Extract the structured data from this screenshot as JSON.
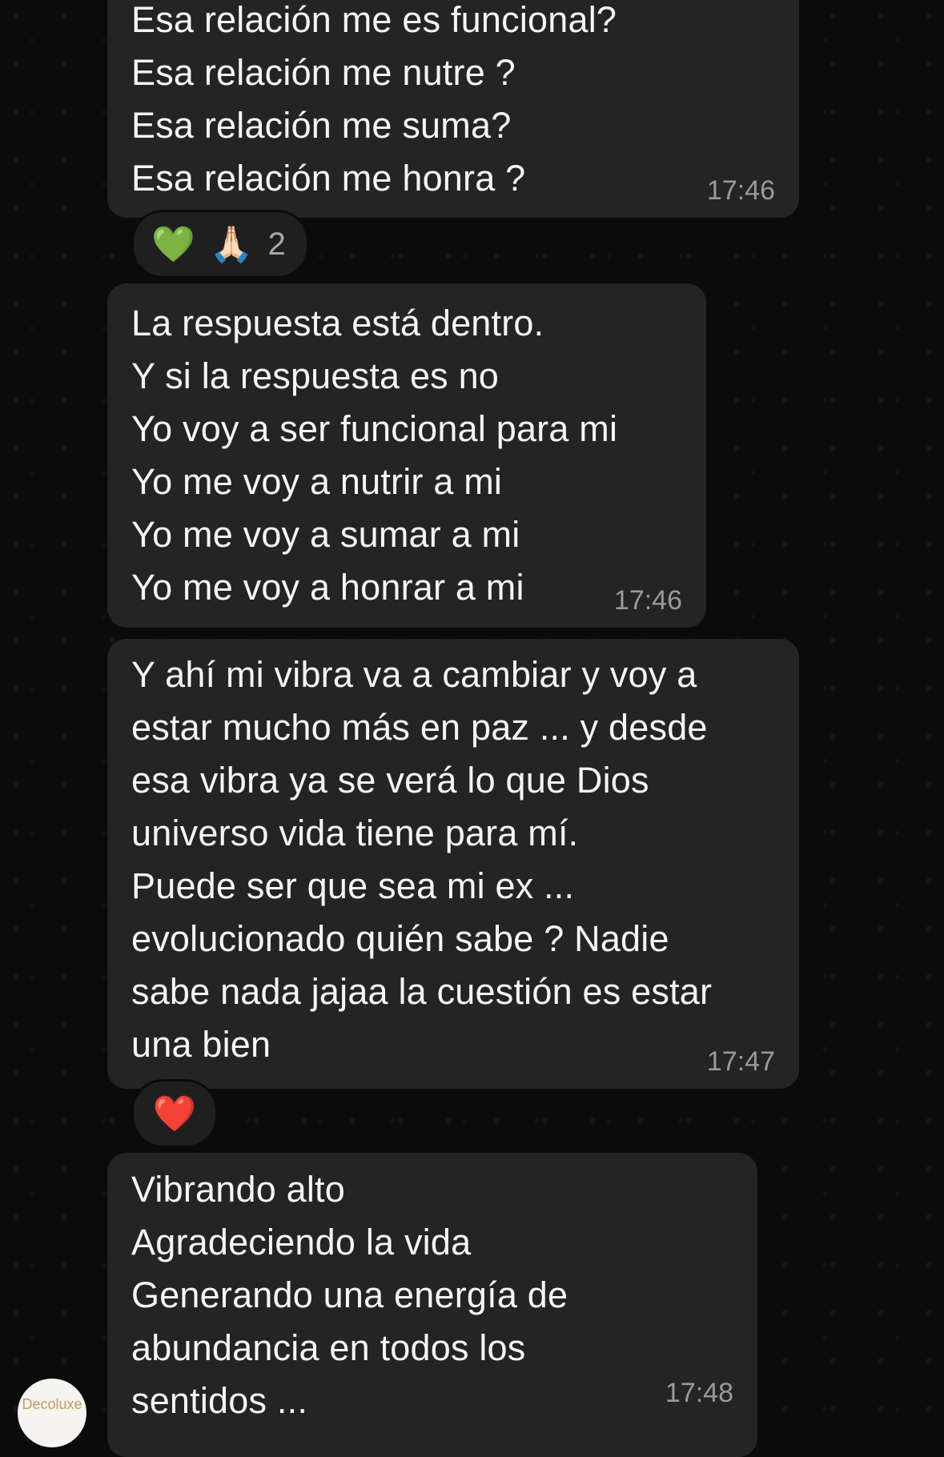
{
  "messages": [
    {
      "lines": [
        "Esa relación me es funcional?",
        "Esa relación me nutre ?",
        "Esa relación me suma?",
        "Esa relación me honra ?"
      ],
      "time": "17:46"
    },
    {
      "lines": [
        "La respuesta está dentro.",
        "Y si la respuesta es no",
        "Yo voy a ser funcional para mi",
        "Yo me voy a nutrir a mi",
        "Yo me voy a sumar a mi",
        "Yo me voy a honrar a mi"
      ],
      "time": "17:46"
    },
    {
      "lines": [
        "Y ahí mi vibra va a cambiar y voy a",
        "estar mucho más en paz ... y desde",
        "esa vibra ya se verá lo que Dios",
        "universo vida tiene para mí.",
        "Puede ser que sea mi ex ...",
        "evolucionado quién sabe ? Nadie",
        "sabe nada jajaa la cuestión es estar",
        "una bien"
      ],
      "time": "17:47"
    },
    {
      "lines": [
        "Vibrando alto",
        "Agradeciendo la vida",
        "Generando una energía de",
        "abundancia en todos los",
        "sentidos ..."
      ],
      "time": "17:48"
    }
  ],
  "reactions": {
    "first": {
      "emojis": [
        "💚",
        "🙏🏻"
      ],
      "count": "2"
    },
    "second": {
      "emojis": [
        "❤️"
      ]
    }
  },
  "avatar": {
    "label": "Decoluxe"
  }
}
